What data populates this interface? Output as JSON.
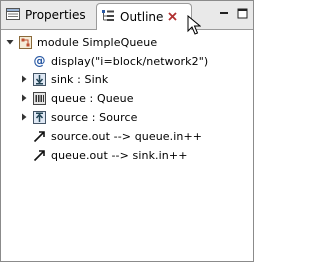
{
  "tabs": [
    {
      "label": "Properties",
      "icon": "properties-icon"
    },
    {
      "label": "Outline",
      "icon": "outline-icon",
      "active": true
    }
  ],
  "tree": {
    "root": {
      "label": "module SimpleQueue",
      "icon": "module-icon",
      "expanded": true
    },
    "children": [
      {
        "label": "display(\"i=block/network2\")",
        "icon": "at-sign-icon",
        "expandable": false
      },
      {
        "label": "sink : Sink",
        "icon": "sink-icon",
        "expandable": true
      },
      {
        "label": "queue : Queue",
        "icon": "queue-icon",
        "expandable": true
      },
      {
        "label": "source : Source",
        "icon": "source-icon",
        "expandable": true
      },
      {
        "label": "source.out --> queue.in++",
        "icon": "connection-arrow-icon",
        "expandable": false
      },
      {
        "label": "queue.out --> sink.in++",
        "icon": "connection-arrow-icon",
        "expandable": false
      }
    ]
  },
  "colors": {
    "tabbar": "#e9e9e9",
    "accent": "#b03030",
    "border": "#9b9b9b"
  }
}
